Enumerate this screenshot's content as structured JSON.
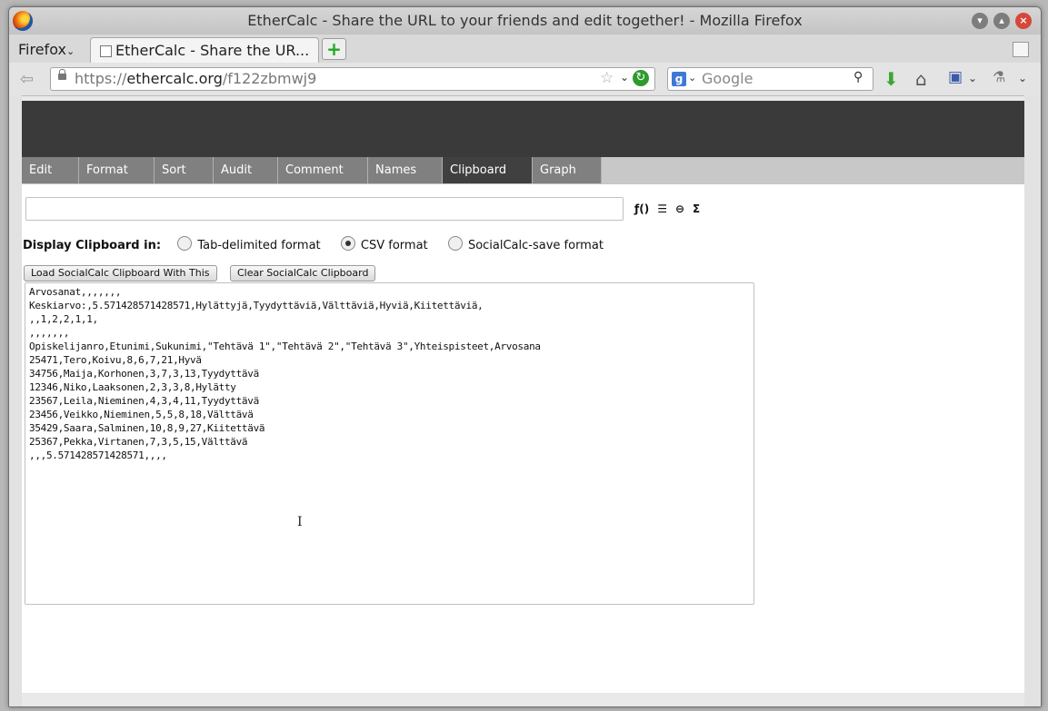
{
  "window": {
    "title": "EtherCalc - Share the URL to your friends and edit together! - Mozilla Firefox"
  },
  "browser": {
    "menu_label": "Firefox",
    "tab_title": "EtherCalc - Share the UR...",
    "url_scheme": "https://",
    "url_domain": "ethercalc.org",
    "url_path": "/f122zbmwj9",
    "search_placeholder": "Google"
  },
  "toolbar": {
    "tabs": [
      {
        "label": "Edit"
      },
      {
        "label": "Format"
      },
      {
        "label": "Sort"
      },
      {
        "label": "Audit"
      },
      {
        "label": "Comment"
      },
      {
        "label": "Names"
      },
      {
        "label": "Clipboard"
      },
      {
        "label": "Graph"
      }
    ],
    "active_tab": "Clipboard"
  },
  "formula_bar": {
    "value": "",
    "icons": [
      "function-icon",
      "text-align-icon",
      "link-icon",
      "sum-icon"
    ]
  },
  "clipboard": {
    "display_label": "Display Clipboard in:",
    "formats": [
      {
        "label": "Tab-delimited format",
        "selected": false
      },
      {
        "label": "CSV format",
        "selected": true
      },
      {
        "label": "SocialCalc-save format",
        "selected": false
      }
    ],
    "load_button": "Load SocialCalc Clipboard With This",
    "clear_button": "Clear SocialCalc Clipboard",
    "lines": [
      "Arvosanat,,,,,,,",
      "Keskiarvo:,5.571428571428571,Hylättyjä,Tyydyttäviä,Välttäviä,Hyviä,Kiitettäviä,",
      ",,1,2,2,1,1,",
      ",,,,,,,",
      "Opiskelijanro,Etunimi,Sukunimi,\"Tehtävä 1\",\"Tehtävä 2\",\"Tehtävä 3\",Yhteispisteet,Arvosana",
      "25471,Tero,Koivu,8,6,7,21,Hyvä",
      "34756,Maija,Korhonen,3,7,3,13,Tyydyttävä",
      "12346,Niko,Laaksonen,2,3,3,8,Hylätty",
      "23567,Leila,Nieminen,4,3,4,11,Tyydyttävä",
      "23456,Veikko,Nieminen,5,5,8,18,Välttävä",
      "35429,Saara,Salminen,10,8,9,27,Kiitettävä",
      "25367,Pekka,Virtanen,7,3,5,15,Välttävä",
      ",,,5.571428571428571,,,,"
    ]
  }
}
